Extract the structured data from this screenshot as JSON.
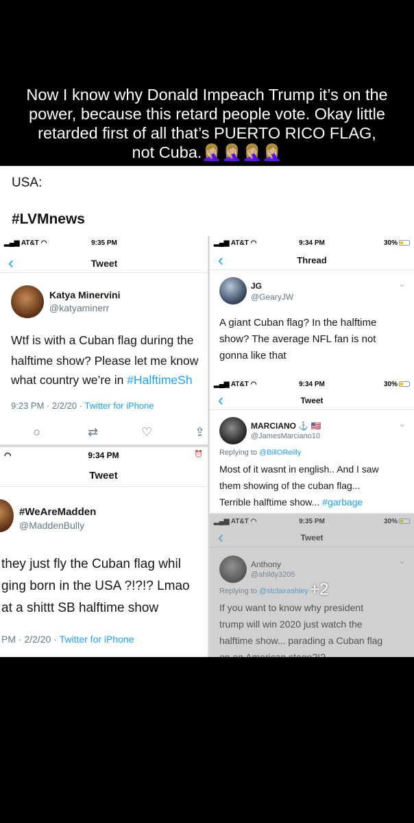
{
  "caption": {
    "line1": "Now I know why Donald Impeach Trump it’s on the",
    "line2": "power, because this retard people vote. Okay little",
    "line3": "retarded first of all that’s PUERTO RICO FLAG,",
    "line4": "not Cuba.",
    "emoji": "🤦🏼‍♀️🤦🏼‍♀️🤦🏼‍♀️🤦🏼‍♀️"
  },
  "header": {
    "country": "USA:",
    "hashtag": "#LVMnews"
  },
  "panel1": {
    "carrier": "AT&T",
    "time": "9:35 PM",
    "title": "Tweet",
    "name": "Katya Minervini",
    "handle": "@katyaminerr",
    "text1": "Wtf is with a Cuban flag during the",
    "text2": "halftime show? Please let me know",
    "text3": "what country we’re in ",
    "text3_link": "#HalftimeSh",
    "meta": "9:23 PM · 2/2/20 · ",
    "source": "Twitter for iPhone"
  },
  "panel2": {
    "carrier": "AT&T",
    "time": "9:34 PM",
    "battery": "30%",
    "title": "Thread",
    "name": "JG",
    "handle": "@GearyJW",
    "text1": "A giant Cuban flag? In the halftime",
    "text2": "show? The average NFL fan is not",
    "text3": "gonna like that"
  },
  "panel3": {
    "carrier": "AT&T",
    "time": "9:34 PM",
    "battery": "30%",
    "title": "Tweet",
    "name": "MARCIANO ⚓ 🇺🇸",
    "handle": "@JamesMarciano10",
    "replying_prefix": "Replying to ",
    "replying_to": "@BillOReilly",
    "text1": "Most of it wasnt in english.. And I saw",
    "text2": "them showing of the cuban flag...",
    "text3": "Terrible halftime show... ",
    "text3_link": "#garbage"
  },
  "panel4": {
    "time": "9:34 PM",
    "title": "Tweet",
    "name": "#WeAreMadden",
    "handle": "@MaddenBully",
    "text1": "they just fly the Cuban flag whil",
    "text2": "ging born in the USA ?!?!? Lmao",
    "text3": "at a shittt SB halftime show",
    "meta": "PM · 2/2/20 · ",
    "source": "Twitter for iPhone"
  },
  "panel5": {
    "carrier": "AT&T",
    "time": "9:35 PM",
    "battery": "30%",
    "title": "Tweet",
    "name": "Anthony",
    "handle": "@ahildy3205",
    "replying_prefix": "Replying to ",
    "replying_to": "@stclairashley",
    "more": "+2",
    "text1": "If you want to know why president",
    "text2": "trump will win 2020 just watch the",
    "text3": "halftime show... parading a Cuban flag",
    "text4": "on an American stage?!?"
  },
  "colors": {
    "link": "#1da1f2",
    "secondary": "#657786",
    "background": "#000000"
  }
}
